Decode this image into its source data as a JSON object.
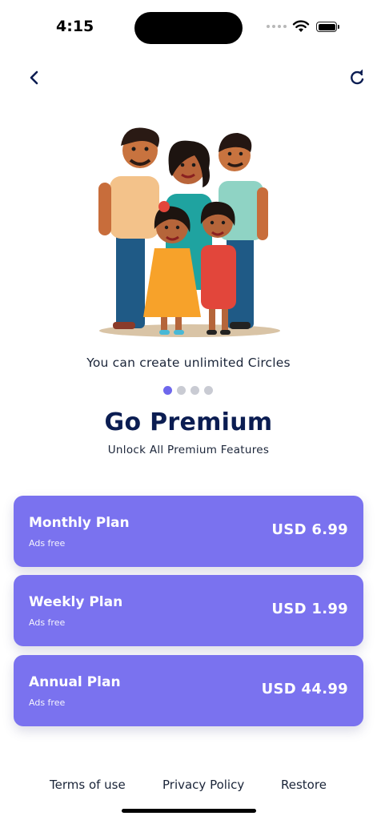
{
  "status_bar": {
    "time": "4:15"
  },
  "onboarding": {
    "caption": "You can create unlimited Circles",
    "pager": {
      "count": 4,
      "active": 0
    }
  },
  "header": {
    "title": "Go Premium",
    "subtitle": "Unlock All Premium Features"
  },
  "plans": [
    {
      "name": "Monthly Plan",
      "feature": "Ads free",
      "price": "USD 6.99"
    },
    {
      "name": "Weekly Plan",
      "feature": "Ads free",
      "price": "USD 1.99"
    },
    {
      "name": "Annual Plan",
      "feature": "Ads free",
      "price": "USD 44.99"
    }
  ],
  "footer": {
    "terms": "Terms of use",
    "privacy": "Privacy Policy",
    "restore": "Restore"
  },
  "colors": {
    "accent": "#7a72ef",
    "title": "#0b1d52",
    "pager_active": "#6e67ec",
    "pager_inactive": "#c9cbd3"
  }
}
